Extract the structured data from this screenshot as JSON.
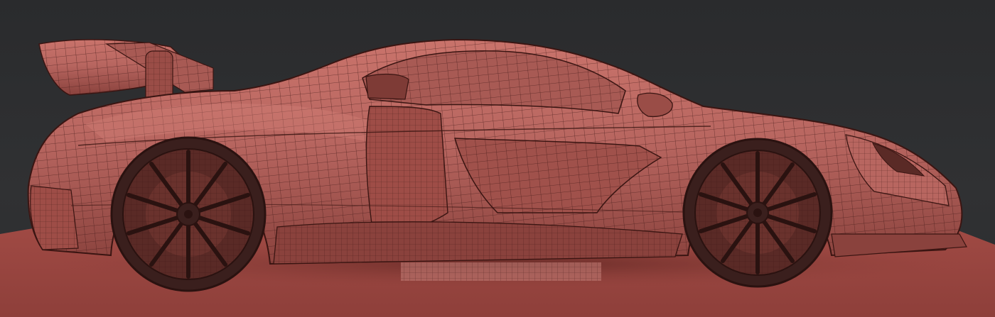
{
  "scene": {
    "subject": "sports-car-wireframe",
    "colors": {
      "background": "#2b2c2e",
      "floor": "#a8504a",
      "floor_dark": "#8e3f3a",
      "body": "#b86660",
      "body_light": "#d8847b",
      "body_dark": "#7e3b36",
      "wire": "#3a1512",
      "tire": "#3a1f1d",
      "rim": "#5a2a26"
    }
  }
}
